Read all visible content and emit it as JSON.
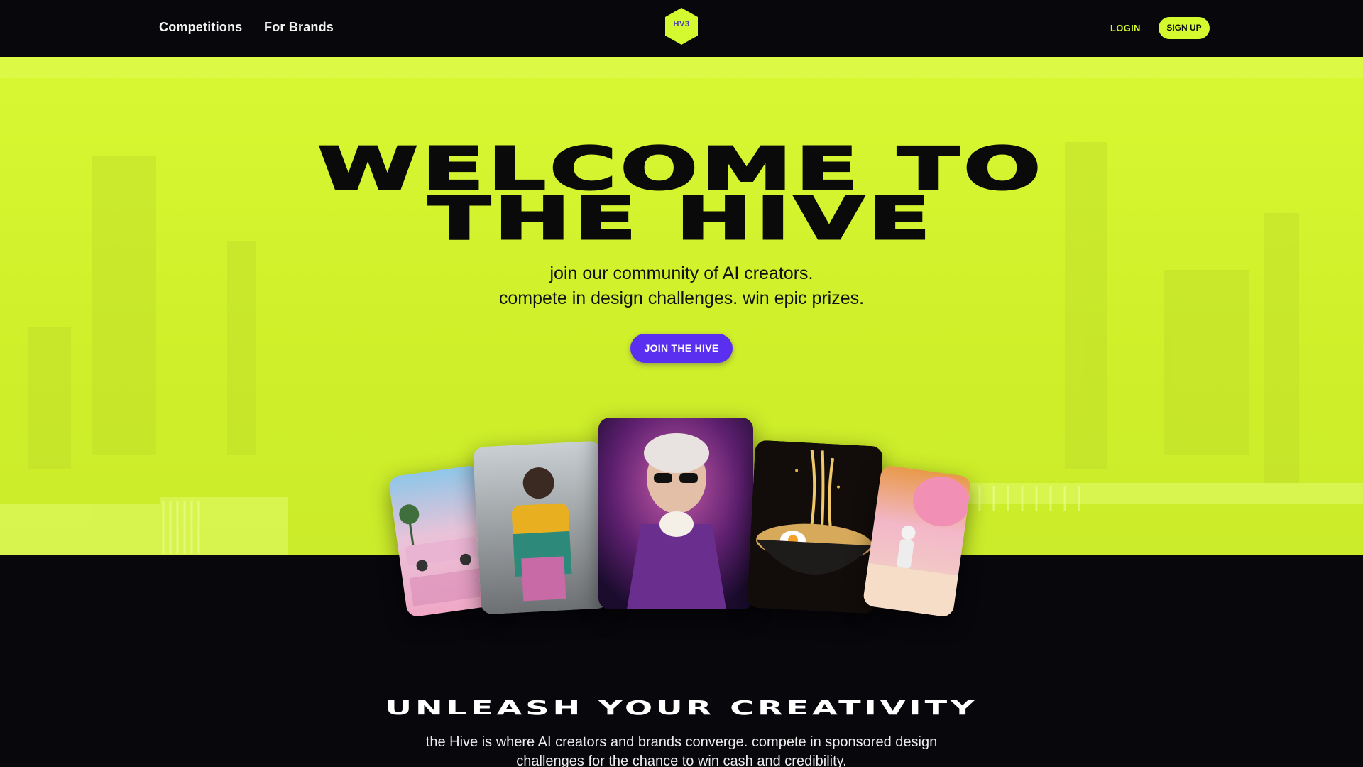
{
  "nav": {
    "links": [
      "Competitions",
      "For Brands"
    ],
    "logo_text": "HV3",
    "login": "LOGIN",
    "signup": "SIGN UP"
  },
  "hero": {
    "title_line1": "WELCOME TO",
    "title_line2": "THE HIVE",
    "subtitle_line1": "join our community of AI creators.",
    "subtitle_line2": "compete in design challenges. win epic prizes.",
    "cta": "JOIN THE HIVE"
  },
  "gallery": {
    "cards": [
      "delorean-pink-card",
      "hooded-youth-card",
      "washington-sunglasses-card",
      "ramen-bowl-card",
      "astronaut-desert-card"
    ]
  },
  "section2": {
    "title": "UNLEASH YOUR CREATIVITY",
    "body_line1": "the Hive is where AI creators and brands converge. compete in sponsored design",
    "body_line2": "challenges for the chance to win cash and credibility."
  },
  "colors": {
    "accent_lime": "#d4f92f",
    "accent_purple": "#5a2ff0",
    "background_dark": "#07070c"
  }
}
